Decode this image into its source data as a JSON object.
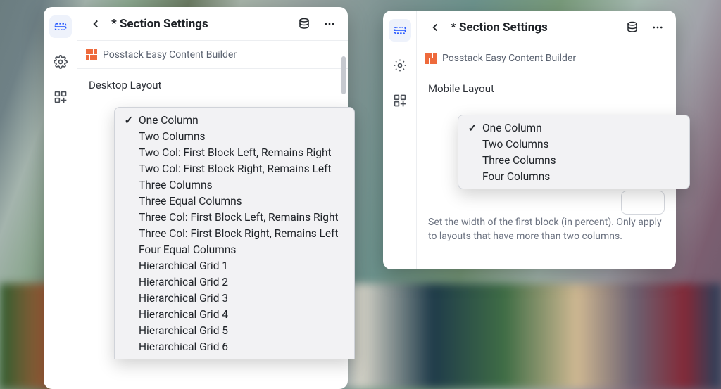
{
  "left": {
    "header": {
      "title": "* Section Settings"
    },
    "brand": "Posstack Easy Content Builder",
    "section_label": "Desktop Layout",
    "dropdown": {
      "selected_index": 0,
      "options": [
        "One Column",
        "Two Columns",
        "Two Col: First Block Left, Remains Right",
        "Two Col: First Block Right, Remains Left",
        "Three Columns",
        "Three Equal Columns",
        "Three Col: First Block Left, Remains Right",
        "Three Col: First Block Right, Remains Left",
        "Four Equal Columns",
        "Hierarchical Grid 1",
        "Hierarchical Grid 2",
        "Hierarchical Grid 3",
        "Hierarchical Grid 4",
        "Hierarchical Grid 5",
        "Hierarchical Grid 6"
      ]
    }
  },
  "right": {
    "header": {
      "title": "* Section Settings"
    },
    "brand": "Posstack Easy Content Builder",
    "section_label": "Mobile Layout",
    "help": "Set the width of the first block (in percent). Only apply to layouts that have more than two columns.",
    "dropdown": {
      "selected_index": 0,
      "options": [
        "One Column",
        "Two Columns",
        "Three Columns",
        "Four Columns"
      ]
    }
  },
  "icons": {
    "section": "section-icon",
    "settings": "gear-icon",
    "apps": "apps-icon",
    "back": "chevron-left-icon",
    "db": "database-icon",
    "more": "more-icon"
  }
}
